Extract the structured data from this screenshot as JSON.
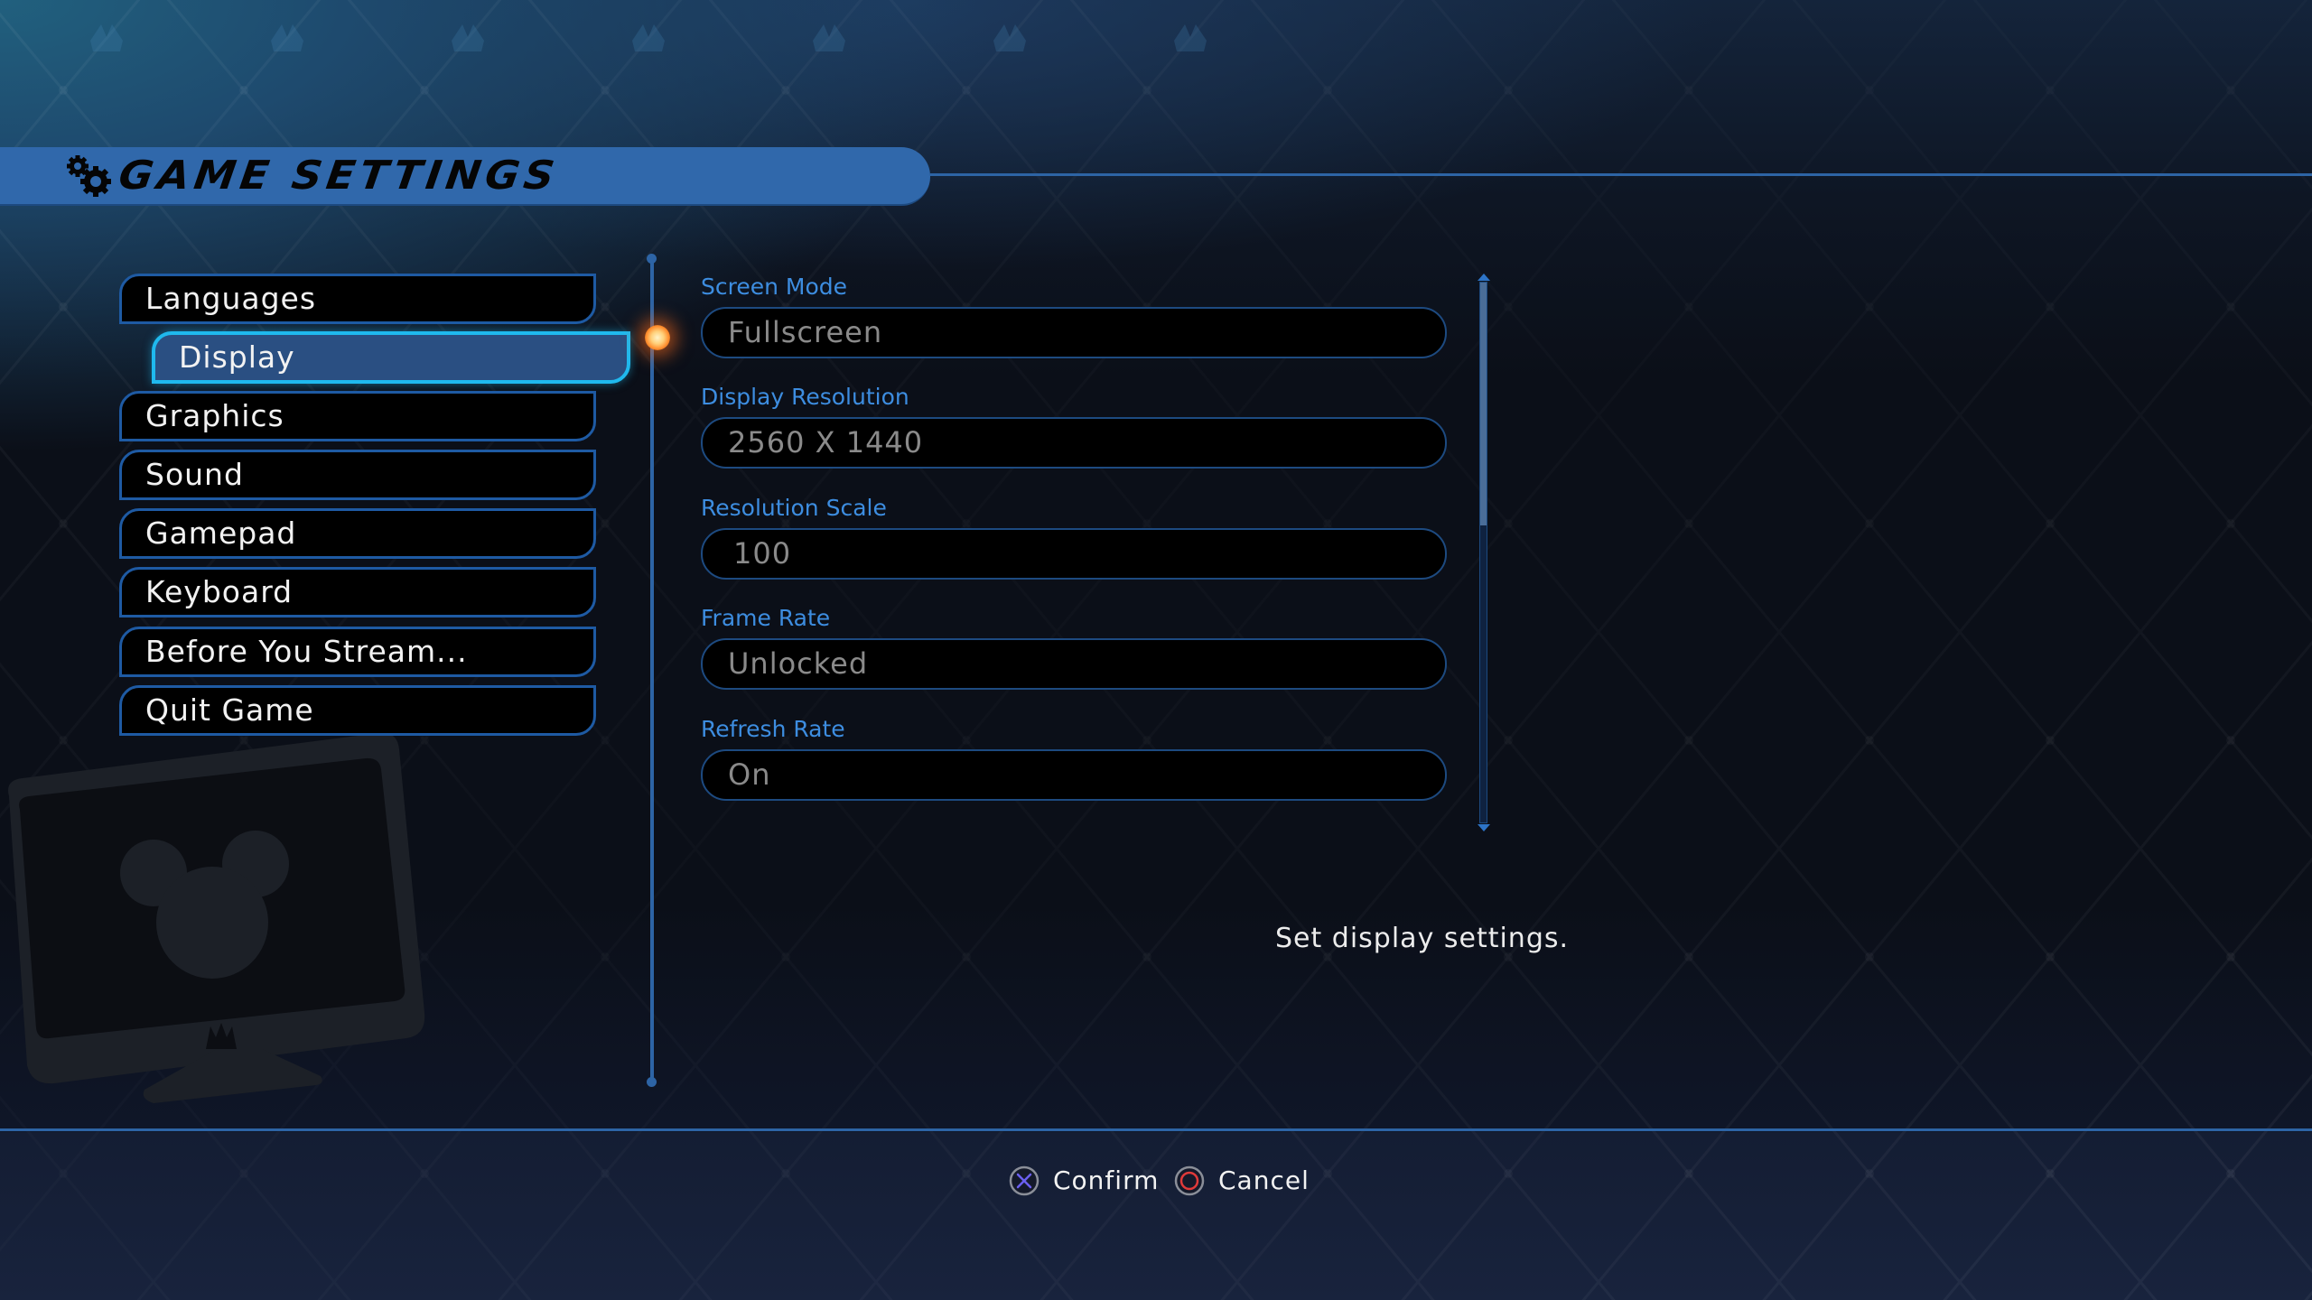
{
  "header": {
    "title": "GAME SETTINGS",
    "icon": "gears-icon"
  },
  "menu": {
    "items": [
      {
        "label": "Languages",
        "active": false
      },
      {
        "label": "Display",
        "active": true
      },
      {
        "label": "Graphics",
        "active": false
      },
      {
        "label": "Sound",
        "active": false
      },
      {
        "label": "Gamepad",
        "active": false
      },
      {
        "label": "Keyboard",
        "active": false
      },
      {
        "label": "Before You Stream...",
        "active": false
      },
      {
        "label": "Quit Game",
        "active": false
      }
    ]
  },
  "settings": {
    "fields": [
      {
        "label": "Screen Mode",
        "value": "Fullscreen"
      },
      {
        "label": "Display Resolution",
        "value": "2560 X 1440"
      },
      {
        "label": "Resolution Scale",
        "value": "100"
      },
      {
        "label": "Frame Rate",
        "value": "Unlocked"
      },
      {
        "label": "Refresh Rate",
        "value": "On"
      }
    ],
    "scroll_position_fraction": 0.45
  },
  "description": "Set display settings.",
  "footer": {
    "confirm": {
      "label": "Confirm",
      "icon": "cross-button-icon"
    },
    "cancel": {
      "label": "Cancel",
      "icon": "circle-button-icon"
    }
  },
  "colors": {
    "accent_blue": "#3068ab",
    "active_border": "#1fb9ee",
    "label_blue": "#3d8de0",
    "value_gray": "#8a8a8a",
    "cross_purple": "#6b5ff0",
    "circle_red": "#e03a3a"
  }
}
